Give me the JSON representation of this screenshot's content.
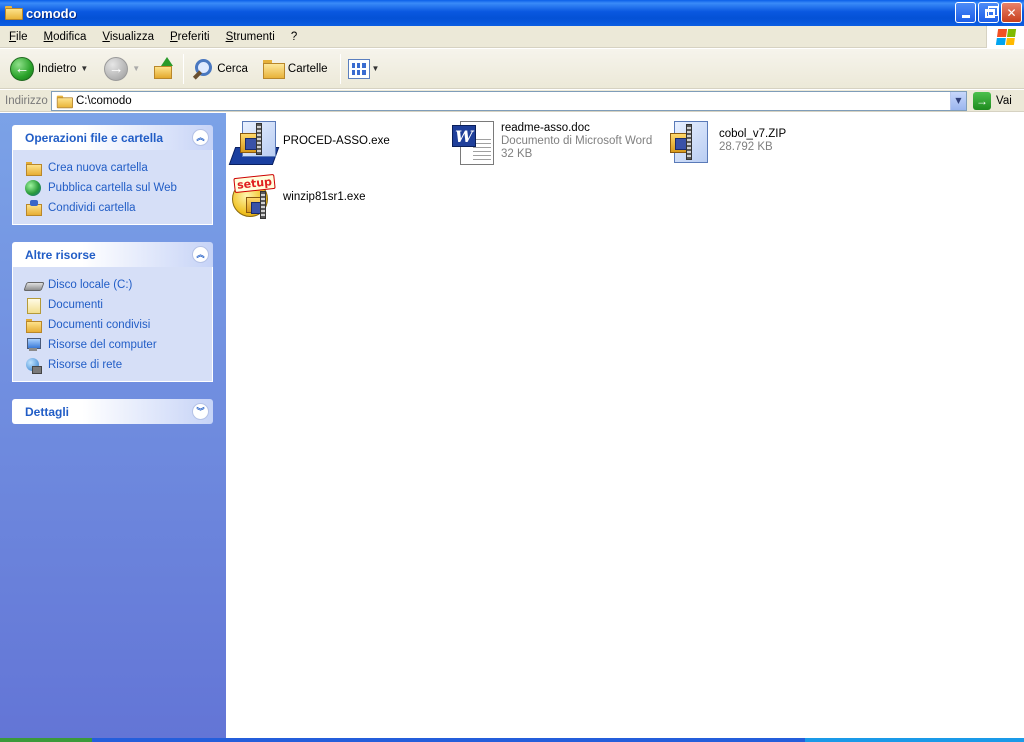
{
  "window": {
    "title": "comodo"
  },
  "menu": {
    "items": [
      "File",
      "Modifica",
      "Visualizza",
      "Preferiti",
      "Strumenti",
      "?"
    ]
  },
  "toolbar": {
    "back_label": "Indietro",
    "search_label": "Cerca",
    "folders_label": "Cartelle"
  },
  "address": {
    "label": "Indirizzo",
    "value": "C:\\comodo",
    "go_label": "Vai"
  },
  "taskpane": {
    "file_tasks": {
      "title": "Operazioni file e cartella",
      "items": [
        "Crea nuova cartella",
        "Pubblica cartella sul Web",
        "Condividi cartella"
      ]
    },
    "other_places": {
      "title": "Altre risorse",
      "items": [
        "Disco locale (C:)",
        "Documenti",
        "Documenti condivisi",
        "Risorse del computer",
        "Risorse di rete"
      ]
    },
    "details": {
      "title": "Dettagli"
    }
  },
  "files": [
    {
      "name": "PROCED-ASSO.exe",
      "icon": "zip-exe-icon"
    },
    {
      "name": "readme-asso.doc",
      "type": "Documento di Microsoft Word",
      "size": "32 KB",
      "icon": "word-document-icon"
    },
    {
      "name": "cobol_v7.ZIP",
      "size": "28.792 KB",
      "icon": "zip-archive-icon"
    },
    {
      "name": "winzip81sr1.exe",
      "icon": "setup-icon"
    }
  ]
}
